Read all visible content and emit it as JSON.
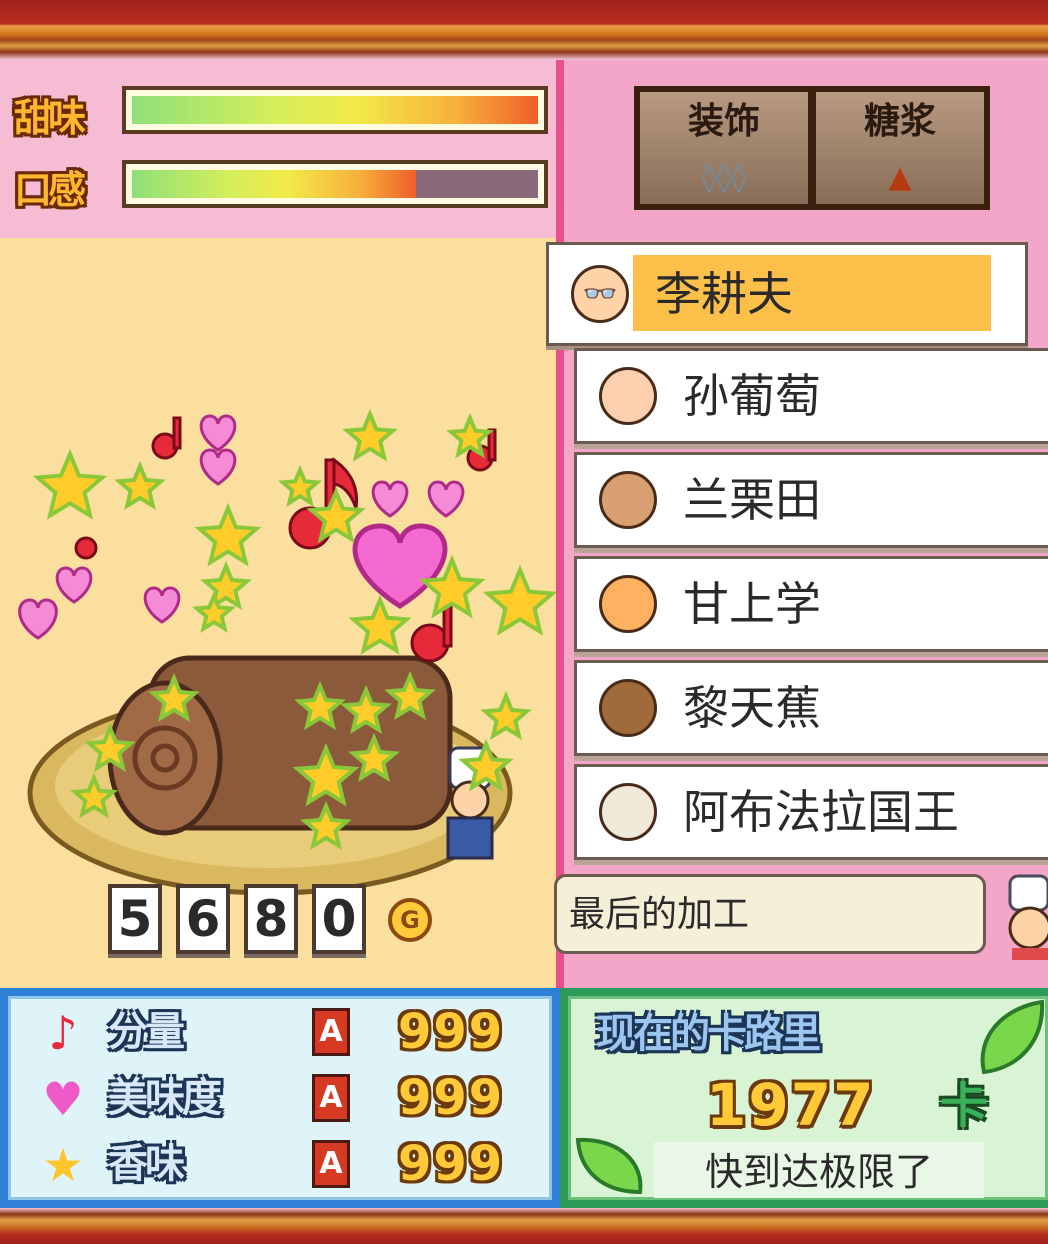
{
  "meters": [
    {
      "label": "甜味",
      "level_percent": 100
    },
    {
      "label": "口感",
      "level_percent": 70
    }
  ],
  "tabs": [
    {
      "label": "装饰",
      "sub": "◊◊◊"
    },
    {
      "label": "糖浆",
      "sub": "▲"
    }
  ],
  "characters": {
    "selected": "李耕夫",
    "list": [
      "孙葡萄",
      "兰栗田",
      "甘上学",
      "黎天蕉",
      "阿布法拉国王"
    ]
  },
  "bubble_text": "最后的加工",
  "price": {
    "digits": [
      "5",
      "6",
      "8",
      "0"
    ],
    "currency": "G"
  },
  "stats": [
    {
      "icon": "♪",
      "label": "分量",
      "grade": "A",
      "value": "999"
    },
    {
      "icon": "♥",
      "label": "美味度",
      "grade": "A",
      "value": "999"
    },
    {
      "icon": "★",
      "label": "香味",
      "grade": "A",
      "value": "999"
    }
  ],
  "calorie": {
    "title": "现在的卡路里",
    "value": "1977",
    "unit": "卡",
    "status": "快到达极限了"
  },
  "colors": {
    "accent_pink": "#e74f8f",
    "selection": "#fbbf4a",
    "stats_blue": "#2e7fd6",
    "calorie_green": "#2e9a58"
  }
}
